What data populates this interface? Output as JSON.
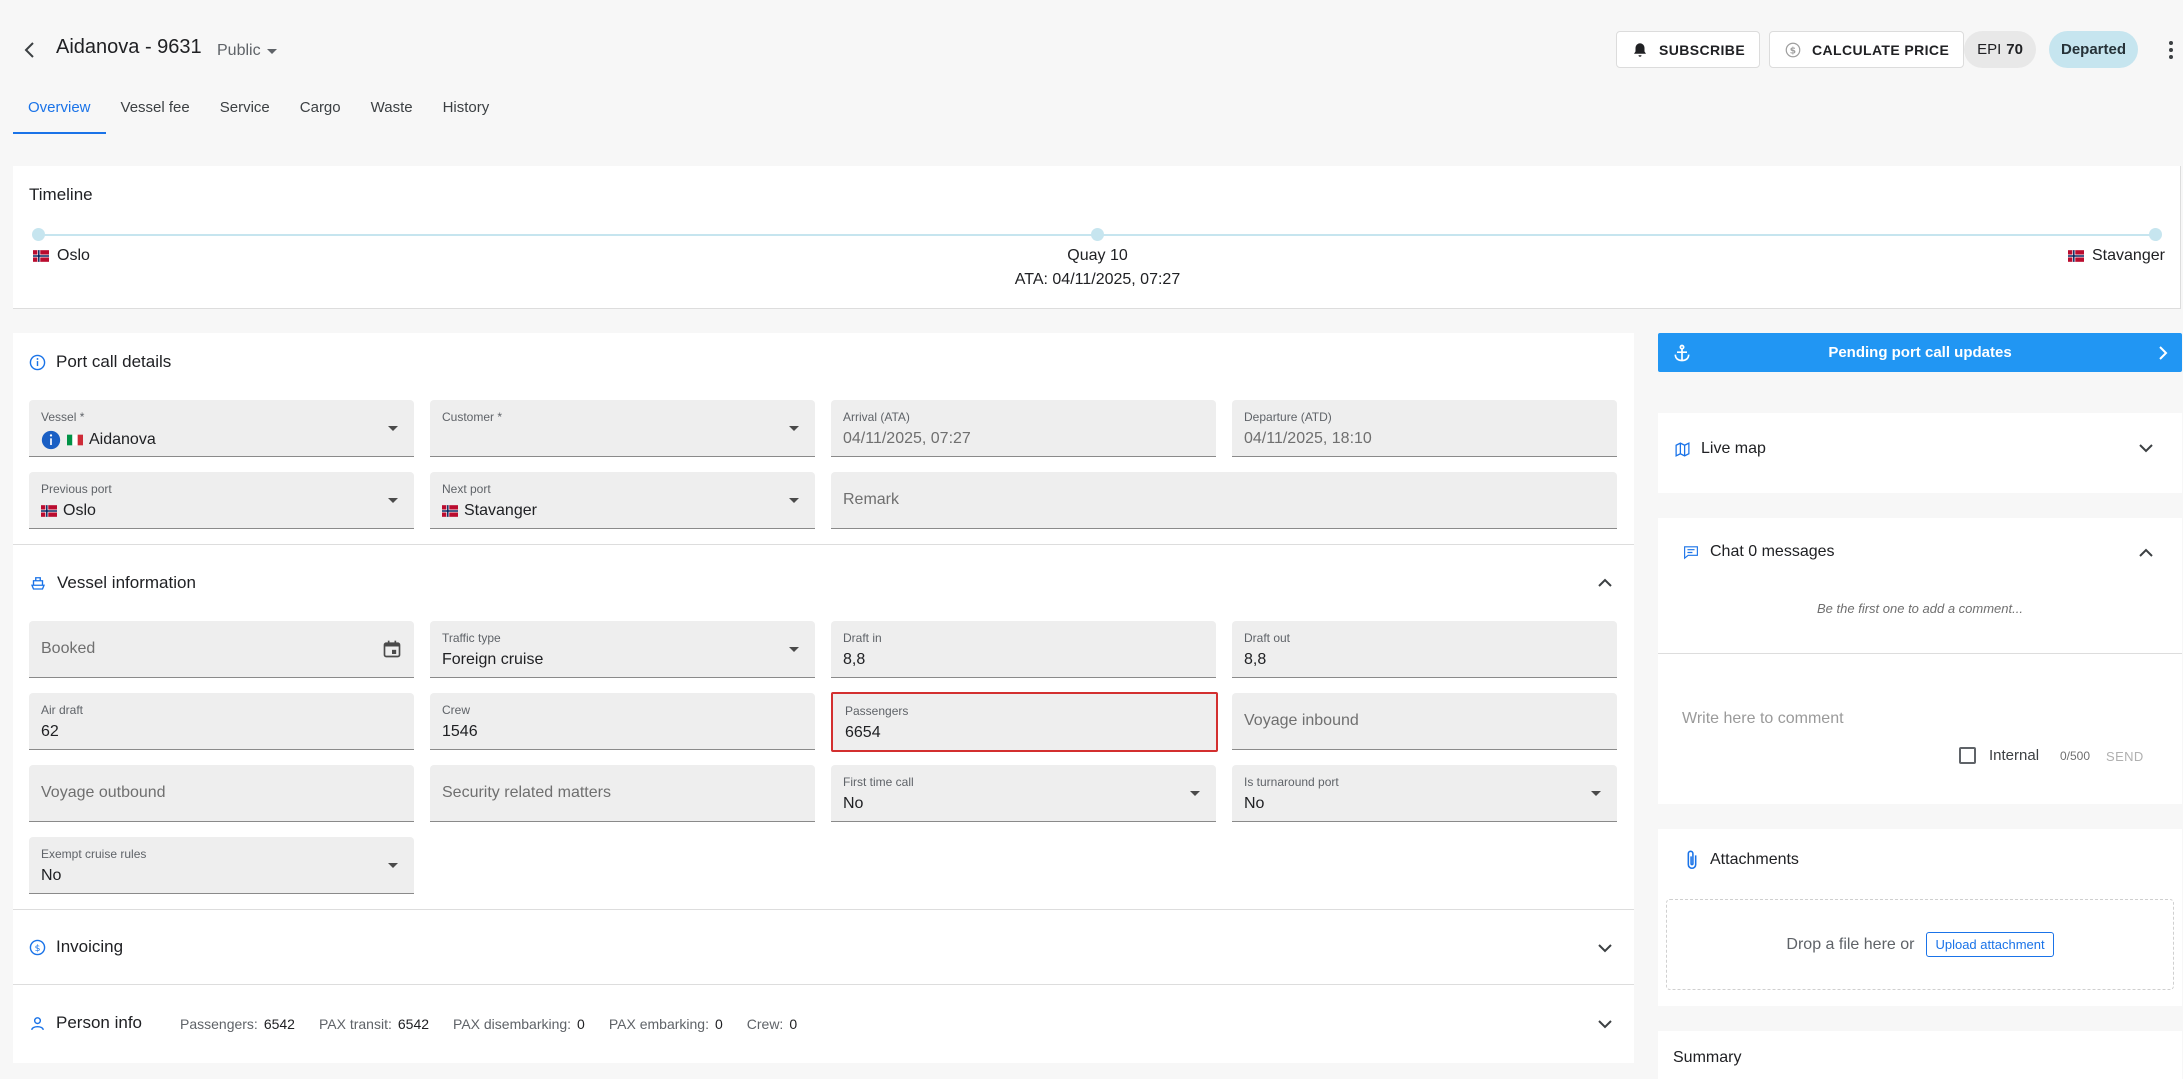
{
  "header": {
    "title": "Aidanova - 9631",
    "visibility": "Public",
    "subscribe": "SUBSCRIBE",
    "calc_price": "CALCULATE PRICE",
    "epi_label": "EPI",
    "epi_value": "70",
    "status": "Departed"
  },
  "tabs": [
    "Overview",
    "Vessel fee",
    "Service",
    "Cargo",
    "Waste",
    "History"
  ],
  "timeline": {
    "title": "Timeline",
    "start": "Oslo",
    "mid": "Quay 10",
    "mid_sub": "ATA: 04/11/2025, 07:27",
    "end": "Stavanger"
  },
  "port_call": {
    "title": "Port call details",
    "vessel_label": "Vessel *",
    "vessel_value": "Aidanova",
    "customer_label": "Customer *",
    "arrival_label": "Arrival (ATA)",
    "arrival_value": "04/11/2025, 07:27",
    "departure_label": "Departure (ATD)",
    "departure_value": "04/11/2025, 18:10",
    "prev_label": "Previous port",
    "prev_value": "Oslo",
    "next_label": "Next port",
    "next_value": "Stavanger",
    "remark_ph": "Remark"
  },
  "vessel_info": {
    "title": "Vessel information",
    "booked_ph": "Booked",
    "traffic_label": "Traffic type",
    "traffic_value": "Foreign cruise",
    "draft_in_label": "Draft in",
    "draft_in_value": "8,8",
    "draft_out_label": "Draft out",
    "draft_out_value": "8,8",
    "air_label": "Air draft",
    "air_value": "62",
    "crew_label": "Crew",
    "crew_value": "1546",
    "pass_label": "Passengers",
    "pass_value": "6654",
    "voy_in_ph": "Voyage inbound",
    "voy_out_ph": "Voyage outbound",
    "security_ph": "Security related matters",
    "first_label": "First time call",
    "first_value": "No",
    "turn_label": "Is turnaround port",
    "turn_value": "No",
    "exempt_label": "Exempt cruise rules",
    "exempt_value": "No"
  },
  "invoicing": {
    "title": "Invoicing"
  },
  "person_info": {
    "title": "Person info",
    "passengers_label": "Passengers:",
    "passengers_value": "6542",
    "transit_label": "PAX transit:",
    "transit_value": "6542",
    "disemb_label": "PAX disembarking:",
    "disemb_value": "0",
    "emb_label": "PAX embarking:",
    "emb_value": "0",
    "crew_label": "Crew:",
    "crew_value": "0"
  },
  "right": {
    "pending": "Pending port call updates",
    "live_map": "Live map",
    "chat_title": "Chat 0 messages",
    "chat_empty": "Be the first one to add a comment...",
    "comment_ph": "Write here to comment",
    "internal": "Internal",
    "counter": "0/500",
    "send": "SEND",
    "attachments": "Attachments",
    "drop_text": "Drop a file here or",
    "upload": "Upload attachment",
    "summary": "Summary"
  },
  "colors": {
    "accent": "#1a73e8",
    "pending_bg": "#2196f3",
    "status_bg": "#c6e5ef",
    "error": "#d32f2f"
  }
}
